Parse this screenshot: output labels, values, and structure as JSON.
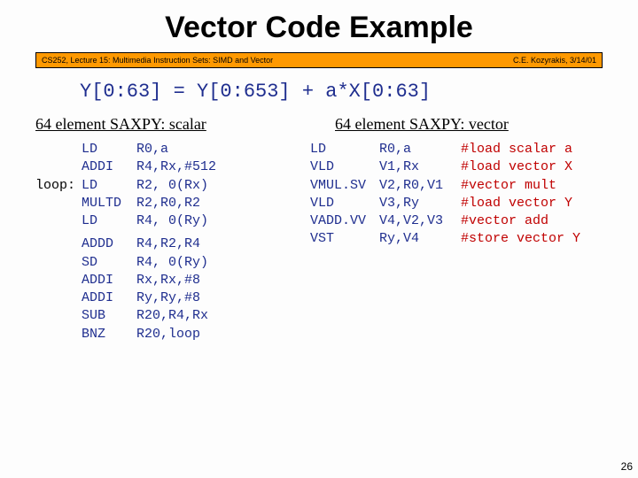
{
  "title": "Vector Code Example",
  "header": {
    "left": "CS252, Lecture 15: Multimedia Instruction Sets: SIMD and Vector",
    "right": "C.E. Kozyrakis, 3/14/01"
  },
  "equation": "Y[0:63] = Y[0:653] + a*X[0:63]",
  "scalar": {
    "heading": "64 element SAXPY: scalar",
    "rows": [
      {
        "label": "",
        "op": "LD",
        "args": "R0,a"
      },
      {
        "label": "",
        "op": "ADDI",
        "args": "R4,Rx,#512"
      },
      {
        "label": "loop:",
        "op": "LD",
        "args": "R2, 0(Rx)"
      },
      {
        "label": "",
        "op": "MULTD",
        "args": "R2,R0,R2"
      },
      {
        "label": "",
        "op": "LD",
        "args": "R4, 0(Ry)"
      },
      {
        "label": "",
        "op": "ADDD",
        "args": "R4,R2,R4"
      },
      {
        "label": "",
        "op": "SD",
        "args": "R4, 0(Ry)"
      },
      {
        "label": "",
        "op": "ADDI",
        "args": "Rx,Rx,#8"
      },
      {
        "label": "",
        "op": "ADDI",
        "args": "Ry,Ry,#8"
      },
      {
        "label": "",
        "op": "SUB",
        "args": "R20,R4,Rx"
      },
      {
        "label": "",
        "op": "BNZ",
        "args": "R20,loop"
      }
    ]
  },
  "vector": {
    "heading": "64 element SAXPY: vector",
    "rows": [
      {
        "op": "LD",
        "args": "R0,a",
        "comment": "#load scalar a"
      },
      {
        "op": "VLD",
        "args": "V1,Rx",
        "comment": "#load vector X"
      },
      {
        "op": "VMUL.SV",
        "args": "V2,R0,V1",
        "comment": "#vector mult"
      },
      {
        "op": "VLD",
        "args": "V3,Ry",
        "comment": "#load vector Y"
      },
      {
        "op": "VADD.VV",
        "args": "V4,V2,V3",
        "comment": "#vector add"
      },
      {
        "op": "VST",
        "args": "Ry,V4",
        "comment": "#store vector Y"
      }
    ]
  },
  "page": "26"
}
